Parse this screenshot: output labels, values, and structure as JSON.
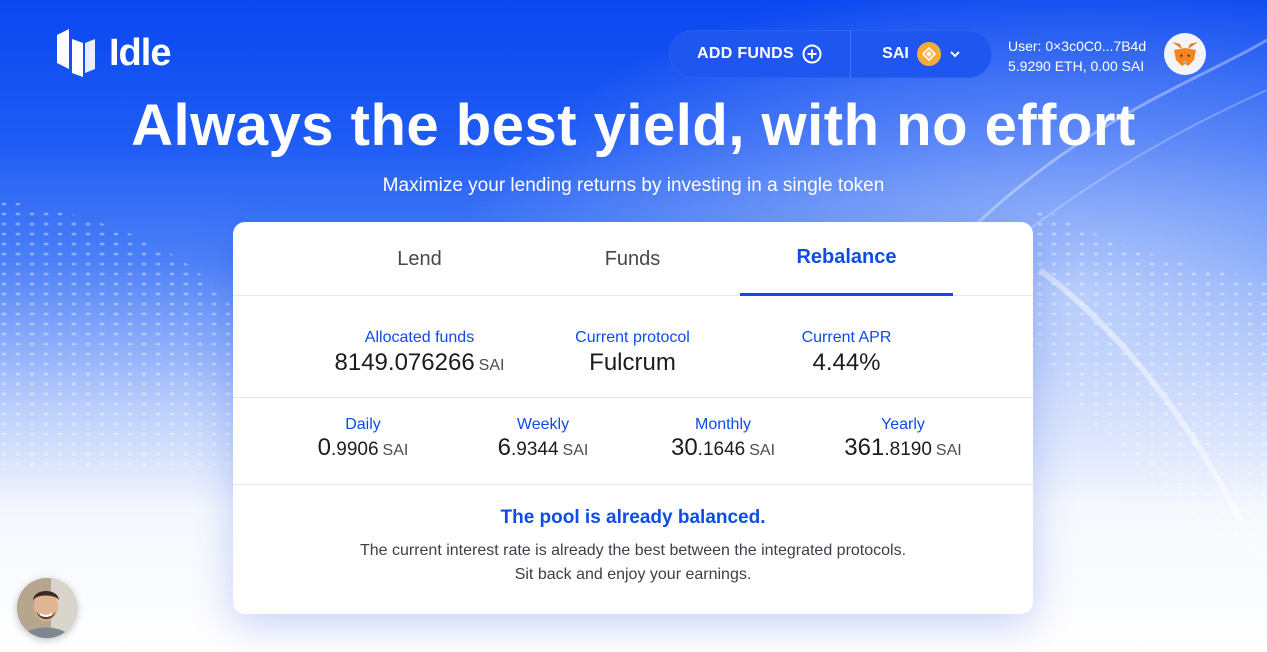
{
  "brand": {
    "name": "Idle"
  },
  "header": {
    "add_funds_label": "ADD FUNDS",
    "token_label": "SAI",
    "user_line1": "User:  0×3c0C0...7B4d",
    "user_line2": "5.9290 ETH, 0.00 SAI"
  },
  "hero": {
    "title": "Always the best yield, with no effort",
    "subtitle": "Maximize your lending returns by investing in a single token"
  },
  "tabs": [
    {
      "label": "Lend",
      "active": false
    },
    {
      "label": "Funds",
      "active": false
    },
    {
      "label": "Rebalance",
      "active": true
    }
  ],
  "summary": {
    "allocated_label": "Allocated funds",
    "allocated_value": "8149.076266",
    "allocated_unit": "SAI",
    "protocol_label": "Current protocol",
    "protocol_value": "Fulcrum",
    "apr_label": "Current APR",
    "apr_value": "4.44%"
  },
  "earnings": [
    {
      "label": "Daily",
      "int": "0",
      "dec": ".9906",
      "unit": "SAI"
    },
    {
      "label": "Weekly",
      "int": "6",
      "dec": ".9344",
      "unit": "SAI"
    },
    {
      "label": "Monthly",
      "int": "30",
      "dec": ".1646",
      "unit": "SAI"
    },
    {
      "label": "Yearly",
      "int": "361",
      "dec": ".8190",
      "unit": "SAI"
    }
  ],
  "message": {
    "title": "The pool is already balanced.",
    "line1": "The current interest rate is already the best between the integrated protocols.",
    "line2": "Sit back and enjoy your earnings."
  },
  "colors": {
    "accent": "#0d4de6",
    "background_top": "#0a47f0",
    "token": "#f5ac37"
  },
  "icons": [
    "plus-circle-icon",
    "sai-token-icon",
    "chevron-down-icon",
    "metamask-fox-icon"
  ]
}
